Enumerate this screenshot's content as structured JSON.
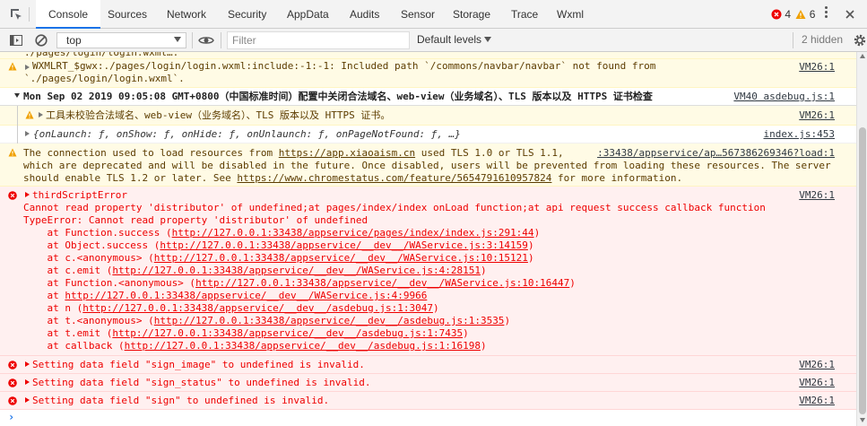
{
  "tabs": [
    "Console",
    "Sources",
    "Network",
    "Security",
    "AppData",
    "Audits",
    "Sensor",
    "Storage",
    "Trace",
    "Wxml"
  ],
  "counts": {
    "errors": "4",
    "warnings": "6"
  },
  "toolbar": {
    "context": "top",
    "filter_placeholder": "Filter",
    "levels": "Default levels",
    "hidden": "2 hidden"
  },
  "icons": [
    "inspect-icon",
    "device-icon",
    "sidebar-icon",
    "clear-icon",
    "eye-icon",
    "gear-icon",
    "more-icon",
    "close-icon"
  ],
  "colors": {
    "accent": "#1a73e8",
    "error": "#e00000",
    "warning": "#f0a000"
  },
  "log": {
    "cut_line": "./pages/login/login.wxml….",
    "warn1": {
      "l1": "WXMLRT_$gwx:./pages/login/login.wxml:include:-1:-1: Included path `/commons/navbar/navbar` not found from",
      "l2": "`./pages/login/login.wxml`.",
      "src": "VM26:1"
    },
    "group": {
      "text": "Mon Sep 02 2019 09:05:08 GMT+0800（中国标准时间）配置中关闭合法域名、web-view（业务域名）、TLS 版本以及 HTTPS 证书检查",
      "src": "VM40 asdebug.js:1"
    },
    "warn2": {
      "text": "工具未校验合法域名、web-view（业务域名）、TLS 版本以及 HTTPS 证书。",
      "src": "VM26:1"
    },
    "obj": {
      "text": "{onLaunch: ƒ, onShow: ƒ, onHide: ƒ, onUnlaunch: ƒ, onPageNotFound: ƒ, …}",
      "src": "index.js:453"
    },
    "tls": {
      "a": "The connection used to load resources from ",
      "b": "https://app.xiaoaism.cn",
      "c": " used TLS 1.0 or TLS 1.1,",
      "src": ":33438/appservice/ap…567386269346?load:1",
      "l2": "which are deprecated and will be disabled in the future. Once disabled, users will be prevented from loading these resources. The server",
      "l3a": "should enable TLS 1.2 or later. See ",
      "l3b": "https://www.chromestatus.com/feature/5654791610957824",
      "l3c": " for more information."
    },
    "err": {
      "title": "thirdScriptError",
      "src": "VM26:1",
      "l1": "Cannot read property 'distributor' of undefined;at pages/index/index onLoad function;at api request success callback function",
      "l2": "TypeError: Cannot read property 'distributor' of undefined",
      "stack": [
        {
          "p": "    at Function.success (",
          "u": "http://127.0.0.1:33438/appservice/pages/index/index.js:291:44",
          "s": ")"
        },
        {
          "p": "    at Object.success (",
          "u": "http://127.0.0.1:33438/appservice/__dev__/WAService.js:3:14159",
          "s": ")"
        },
        {
          "p": "    at c.<anonymous> (",
          "u": "http://127.0.0.1:33438/appservice/__dev__/WAService.js:10:15121",
          "s": ")"
        },
        {
          "p": "    at c.emit (",
          "u": "http://127.0.0.1:33438/appservice/__dev__/WAService.js:4:28151",
          "s": ")"
        },
        {
          "p": "    at Function.<anonymous> (",
          "u": "http://127.0.0.1:33438/appservice/__dev__/WAService.js:10:16447",
          "s": ")"
        },
        {
          "p": "    at ",
          "u": "http://127.0.0.1:33438/appservice/__dev__/WAService.js:4:9966",
          "s": ""
        },
        {
          "p": "    at n (",
          "u": "http://127.0.0.1:33438/appservice/__dev__/asdebug.js:1:3047",
          "s": ")"
        },
        {
          "p": "    at t.<anonymous> (",
          "u": "http://127.0.0.1:33438/appservice/__dev__/asdebug.js:1:3535",
          "s": ")"
        },
        {
          "p": "    at t.emit (",
          "u": "http://127.0.0.1:33438/appservice/__dev__/asdebug.js:1:7435",
          "s": ")"
        },
        {
          "p": "    at callback (",
          "u": "http://127.0.0.1:33438/appservice/__dev__/asdebug.js:1:16198",
          "s": ")"
        }
      ]
    },
    "set1": {
      "text": "Setting data field \"sign_image\" to undefined is invalid.",
      "src": "VM26:1"
    },
    "set2": {
      "text": "Setting data field \"sign_status\" to undefined is invalid.",
      "src": "VM26:1"
    },
    "set3": {
      "text": "Setting data field \"sign\" to undefined is invalid.",
      "src": "VM26:1"
    },
    "prompt": "›"
  }
}
